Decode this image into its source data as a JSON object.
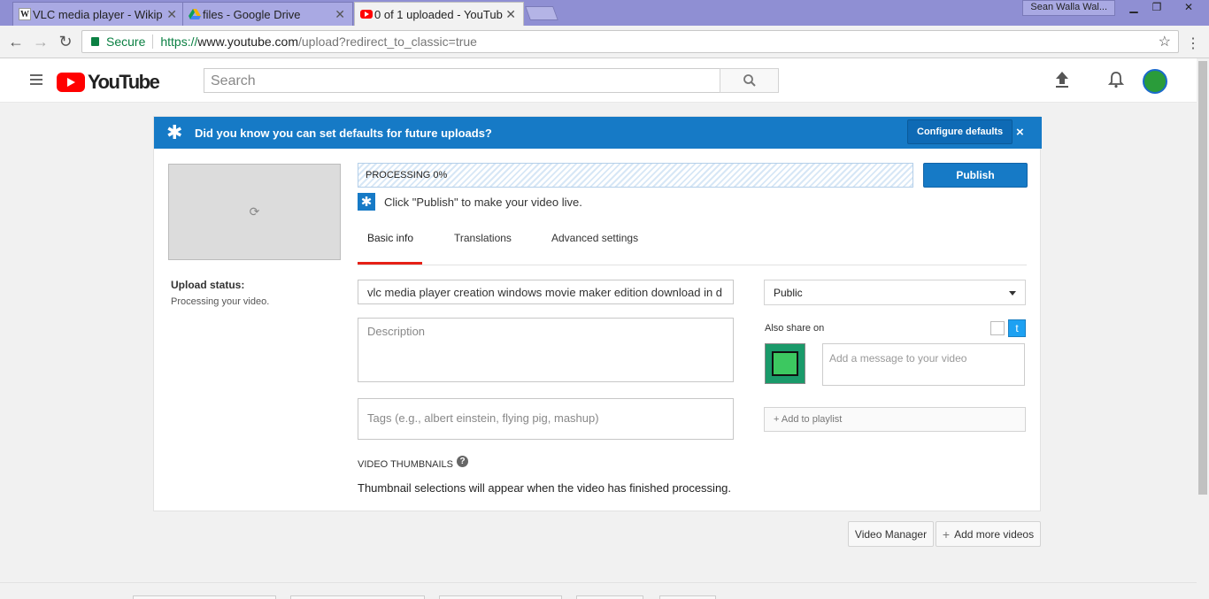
{
  "browser": {
    "tabs": [
      {
        "title": "VLC media player - Wikip",
        "favicon": "W"
      },
      {
        "title": "files - Google Drive",
        "favicon": "drive-icon"
      },
      {
        "title": "0 of 1 uploaded - YouTub",
        "favicon": "youtube-icon"
      }
    ],
    "profile": "Sean Walla Wal...",
    "secure_label": "Secure",
    "url_scheme": "https://",
    "url_host": "www.youtube.com",
    "url_path": "/upload?redirect_to_classic=true"
  },
  "header": {
    "logo_text": "YouTube",
    "search_placeholder": "Search"
  },
  "banner": {
    "text": "Did you know you can set defaults for future uploads?",
    "configure_label": "Configure defaults",
    "close_label": "×"
  },
  "upload": {
    "status_label": "Upload status:",
    "status_text": "Processing your video.",
    "progress_text": "PROCESSING 0%",
    "progress_value": 0,
    "publish_label": "Publish",
    "hint": "Click \"Publish\" to make your video live."
  },
  "tabs": [
    "Basic info",
    "Translations",
    "Advanced settings"
  ],
  "form": {
    "title_value": "vlc media player creation windows movie maker edition download in d",
    "description_placeholder": "Description",
    "tags_placeholder": "Tags (e.g., albert einstein, flying pig, mashup)",
    "privacy_value": "Public",
    "also_share_label": "Also share on",
    "message_placeholder": "Add a message to your video",
    "playlist_label": "+ Add to playlist"
  },
  "thumbnails": {
    "heading": "VIDEO THUMBNAILS",
    "help": "?",
    "desc": "Thumbnail selections will appear when the video has finished processing."
  },
  "footer_buttons": {
    "video_manager": "Video Manager",
    "add_more": "Add more videos"
  },
  "colors": {
    "accent": "#167ac6",
    "brand": "#ff0000",
    "tab_underline": "#e62117"
  }
}
